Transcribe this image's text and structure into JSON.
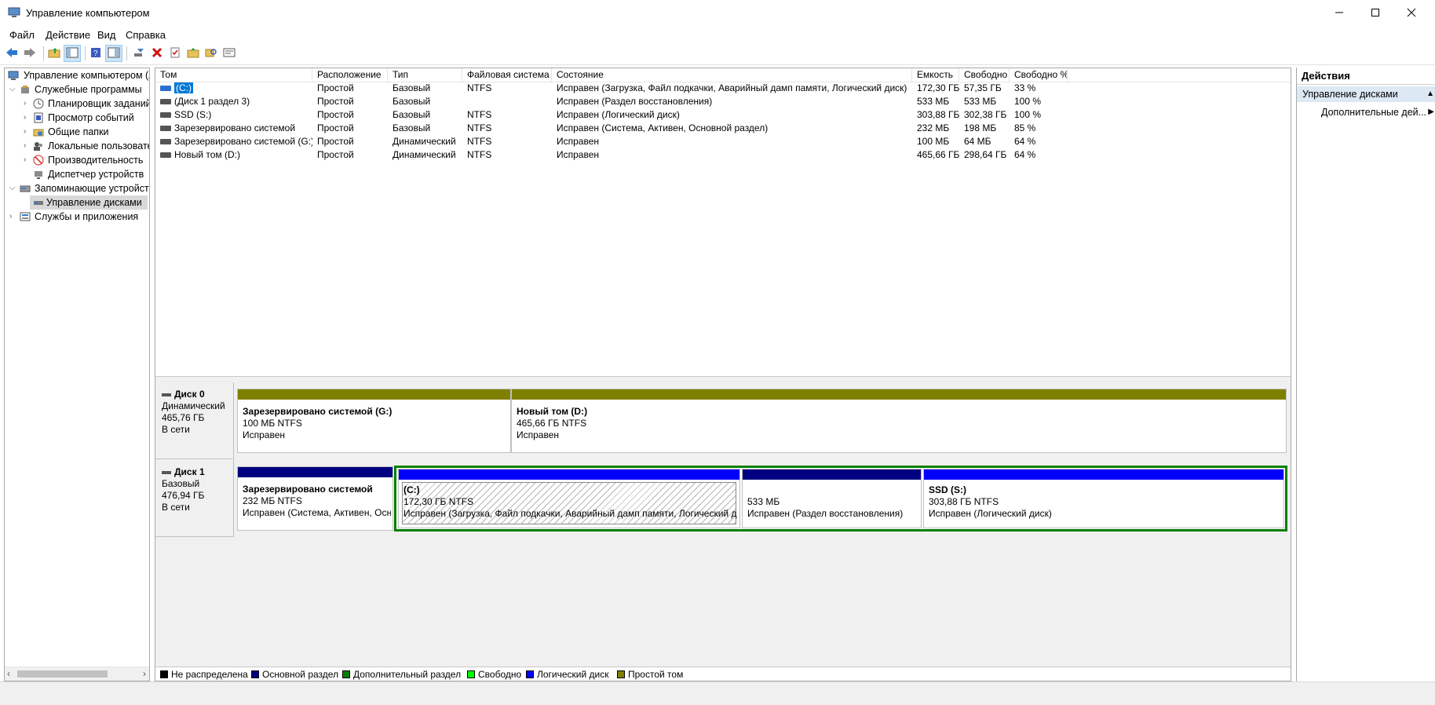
{
  "window": {
    "title": "Управление компьютером",
    "controls": [
      "minimize-icon",
      "maximize-icon",
      "close-icon"
    ]
  },
  "menu": {
    "items": [
      "Файл",
      "Действие",
      "Вид",
      "Справка"
    ]
  },
  "toolbar": {
    "buttons": [
      "back-arrow-icon",
      "forward-arrow-icon",
      "up-folder-icon",
      "show-hide-tree-icon",
      "help-icon",
      "properties-panel-icon",
      "connect-drive-icon",
      "delete-icon",
      "properties-icon",
      "open-folder-icon",
      "search-icon",
      "settings-icon"
    ]
  },
  "tree": {
    "items": [
      {
        "label": "Управление компьютером (л",
        "level": 0
      },
      {
        "label": "Служебные программы",
        "level": 1,
        "expanded": true
      },
      {
        "label": "Планировщик заданий",
        "level": 2
      },
      {
        "label": "Просмотр событий",
        "level": 2
      },
      {
        "label": "Общие папки",
        "level": 2
      },
      {
        "label": "Локальные пользовате",
        "level": 2
      },
      {
        "label": "Производительность",
        "level": 2
      },
      {
        "label": "Диспетчер устройств",
        "level": 2
      },
      {
        "label": "Запоминающие устройст",
        "level": 1,
        "expanded": true
      },
      {
        "label": "Управление дисками",
        "level": 2,
        "selected": true
      },
      {
        "label": "Службы и приложения",
        "level": 1
      }
    ]
  },
  "volumes": {
    "columns": [
      "Том",
      "Расположение",
      "Тип",
      "Файловая система",
      "Состояние",
      "Емкость",
      "Свободно",
      "Свободно %"
    ],
    "rows": [
      [
        "(C:)",
        "Простой",
        "Базовый",
        "NTFS",
        "Исправен (Загрузка, Файл подкачки, Аварийный дамп памяти, Логический диск)",
        "172,30 ГБ",
        "57,35 ГБ",
        "33 %"
      ],
      [
        "(Диск 1 раздел 3)",
        "Простой",
        "Базовый",
        "",
        "Исправен (Раздел восстановления)",
        "533 МБ",
        "533 МБ",
        "100 %"
      ],
      [
        "SSD (S:)",
        "Простой",
        "Базовый",
        "NTFS",
        "Исправен (Логический диск)",
        "303,88 ГБ",
        "302,38 ГБ",
        "100 %"
      ],
      [
        "Зарезервировано системой",
        "Простой",
        "Базовый",
        "NTFS",
        "Исправен (Система, Активен, Основной раздел)",
        "232 МБ",
        "198 МБ",
        "85 %"
      ],
      [
        "Зарезервировано системой (G:)",
        "Простой",
        "Динамический",
        "NTFS",
        "Исправен",
        "100 МБ",
        "64 МБ",
        "64 %"
      ],
      [
        "Новый том (D:)",
        "Простой",
        "Динамический",
        "NTFS",
        "Исправен",
        "465,66 ГБ",
        "298,64 ГБ",
        "64 %"
      ]
    ]
  },
  "disks": [
    {
      "name": "Диск 0",
      "type": "Динамический",
      "size": "465,76 ГБ",
      "status": "В сети",
      "partitions": [
        {
          "title": "Зарезервировано системой  (G:)",
          "line2": "100 МБ NTFS",
          "line3": "Исправен",
          "bar_color": "#808000"
        },
        {
          "title": "Новый том  (D:)",
          "line2": "465,66 ГБ NTFS",
          "line3": "Исправен",
          "bar_color": "#808000"
        }
      ]
    },
    {
      "name": "Диск 1",
      "type": "Базовый",
      "size": "476,94 ГБ",
      "status": "В сети",
      "partitions": [
        {
          "title": "Зарезервировано системой",
          "line2": "232 МБ NTFS",
          "line3": "Исправен (Система, Активен, Осн",
          "bar_color": "#000080"
        },
        {
          "title": "(C:)",
          "line2": "172,30 ГБ NTFS",
          "line3": "Исправен (Загрузка, Файл подкачки, Аварийный дамп памяти, Логический д",
          "bar_color": "#0000ff"
        },
        {
          "title": "",
          "line2": "533 МБ",
          "line3": "Исправен (Раздел восстановления)",
          "bar_color": "#000080"
        },
        {
          "title": "SSD  (S:)",
          "line2": "303,88 ГБ NTFS",
          "line3": "Исправен (Логический диск)",
          "bar_color": "#0000ff"
        }
      ]
    }
  ],
  "legend": [
    {
      "label": "Не распределена",
      "color": "#000000"
    },
    {
      "label": "Основной раздел",
      "color": "#000080"
    },
    {
      "label": "Дополнительный раздел",
      "color": "#008000"
    },
    {
      "label": "Свободно",
      "color": "#00ff00"
    },
    {
      "label": "Логический диск",
      "color": "#0000ff"
    },
    {
      "label": "Простой том",
      "color": "#808000"
    }
  ],
  "actions": {
    "header": "Действия",
    "section": "Управление дисками",
    "more": "Дополнительные дей..."
  },
  "colors": {
    "selection": "#0078d7",
    "extended_border": "#008000"
  }
}
